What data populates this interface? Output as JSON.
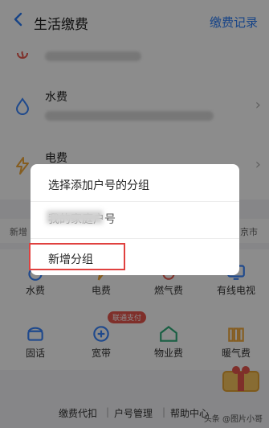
{
  "header": {
    "title": "生活缴费",
    "records_label": "缴费记录"
  },
  "accounts": [
    {
      "name": "水费"
    },
    {
      "name": "电费"
    }
  ],
  "inforow": {
    "left": "新增",
    "right": "京市"
  },
  "services": [
    {
      "label": "水费",
      "icon": "water-drop-icon"
    },
    {
      "label": "电费",
      "icon": "lightning-icon"
    },
    {
      "label": "燃气费",
      "icon": "flame-icon"
    },
    {
      "label": "有线电视",
      "icon": "tv-icon"
    },
    {
      "label": "固话",
      "icon": "phone-icon"
    },
    {
      "label": "宽带",
      "icon": "broadband-icon"
    },
    {
      "label": "物业费",
      "icon": "house-icon"
    },
    {
      "label": "暖气费",
      "icon": "radiator-icon"
    }
  ],
  "badge": "联通支付",
  "footer": {
    "links": [
      "缴费代扣",
      "户号管理",
      "帮助中心"
    ]
  },
  "watermark": "头条 @图片小哥",
  "dialog": {
    "title": "选择添加户号的分组",
    "option1": "我的家庭户号",
    "new_group": "新增分组"
  },
  "colors": {
    "accent": "#2b7cf6",
    "highlight": "#e0413f",
    "water": "#3a86ff",
    "electric": "#f2a93b"
  }
}
